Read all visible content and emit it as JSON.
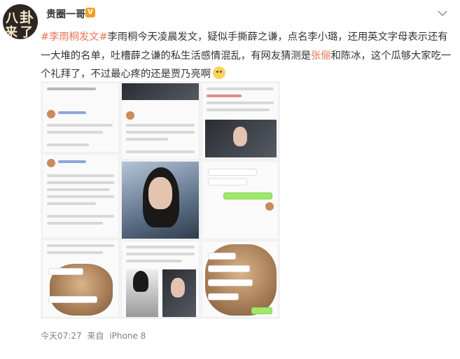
{
  "user": {
    "name": "贵圈一哥",
    "badge": "V",
    "avatar_text": [
      "八",
      "卦",
      "来",
      "了"
    ]
  },
  "post": {
    "topic": "#李雨桐发文#",
    "text_part1": "李雨桐今天凌晨发文，疑似手撕薛之谦，点名李小璐，还用英文字母表示还有一大堆的名单，吐槽薛之谦的私生活感情混乱，有网友猜测是",
    "mention1": "张俪",
    "text_part2": "和陈冰，这个瓜够大家吃一个礼拜了，不过最心疼的还是贾乃亮啊"
  },
  "meta": {
    "time": "今天07:27",
    "source_label": "来自",
    "device": "iPhone 8"
  },
  "colors": {
    "link": "#eb7350",
    "meta": "#808080"
  },
  "icons": {
    "menu": "chevron-down-icon",
    "emoji": "doge-emoji-icon"
  }
}
